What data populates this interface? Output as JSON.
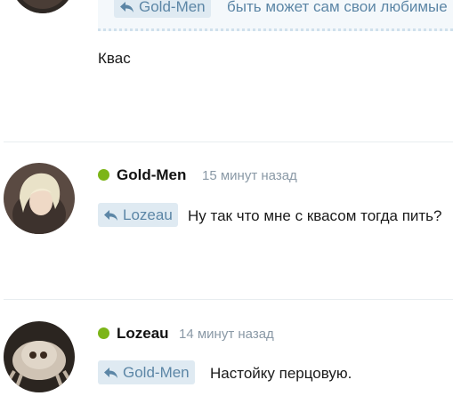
{
  "posts": [
    {
      "quoted": {
        "mention": "Gold-Men",
        "text": "быть может сам свои любимые"
      },
      "text": "Квас"
    },
    {
      "author": "Gold-Men",
      "time": "15 минут назад",
      "mention": "Lozeau",
      "text": "Ну так что мне с квасом тогда пить?"
    },
    {
      "author": "Lozeau",
      "time": "14 минут назад",
      "mention": "Gold-Men",
      "text": "Настойку перцовую."
    }
  ],
  "colors": {
    "online": "#7cb518",
    "chip_bg": "#dfeaf2",
    "chip_text": "#5c86a6",
    "timestamp": "#8a99a6"
  }
}
